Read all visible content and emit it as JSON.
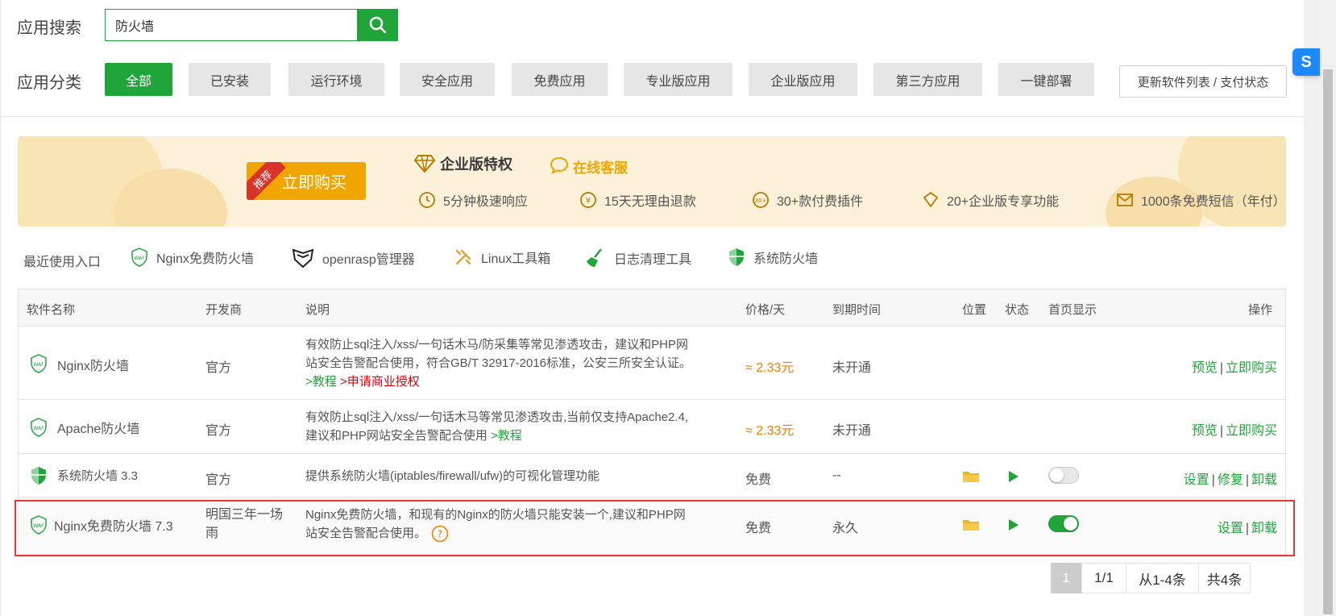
{
  "search": {
    "label": "应用搜索",
    "value": "防火墙"
  },
  "categories": {
    "label": "应用分类",
    "items": [
      "全部",
      "已安装",
      "运行环境",
      "安全应用",
      "免费应用",
      "专业版应用",
      "企业版应用",
      "第三方应用",
      "一键部署"
    ],
    "update_button": "更新软件列表 / 支付状态"
  },
  "banner": {
    "ribbon": "推荐",
    "buy": "立即购买",
    "ent_title": "企业版特权",
    "cs_title": "在线客服",
    "perks": [
      "5分钟极速响应",
      "15天无理由退款",
      "30+款付费插件",
      "20+企业版专享功能",
      "1000条免费短信（年付）"
    ]
  },
  "recent": {
    "label": "最近使用入口",
    "items": [
      "Nginx免费防火墙",
      "openrasp管理器",
      "Linux工具箱",
      "日志清理工具",
      "系统防火墙"
    ]
  },
  "table": {
    "headers": [
      "软件名称",
      "开发商",
      "说明",
      "价格/天",
      "到期时间",
      "位置",
      "状态",
      "首页显示",
      "操作"
    ],
    "rows": [
      {
        "name": "Nginx防火墙",
        "vendor": "官方",
        "desc_line1": "有效防止sql注入/xss/一句话木马/防采集等常见渗透攻击，建议和PHP网",
        "desc_line2": "站安全告警配合使用，符合GB/T 32917-2016标准，公安三所安全认证。",
        "link1": ">教程",
        "link2": ">申请商业授权",
        "price": "≈ 2.33元",
        "expire": "未开通",
        "op1": "预览",
        "op2": "立即购买"
      },
      {
        "name": "Apache防火墙",
        "vendor": "官方",
        "desc_line1": "有效防止sql注入/xss/一句话木马等常见渗透攻击,当前仅支持Apache2.4,",
        "desc_line2": "建议和PHP网站安全告警配合使用",
        "link1": ">教程",
        "price": "≈ 2.33元",
        "expire": "未开通",
        "op1": "预览",
        "op2": "立即购买"
      },
      {
        "name": "系统防火墙 3.3",
        "vendor": "官方",
        "desc_line1": "提供系统防火墙(iptables/firewall/ufw)的可视化管理功能",
        "price": "免费",
        "expire": "--",
        "home_display": false,
        "op1": "设置",
        "op2": "修复",
        "op3": "卸载"
      },
      {
        "name": "Nginx免费防火墙 7.3",
        "vendor_line1": "明国三年一场",
        "vendor_line2": "雨",
        "desc_line1": "Nginx免费防火墙，和现有的Nginx的防火墙只能安装一个,建议和PHP网",
        "desc_line2": "站安全告警配合使用。",
        "price": "免费",
        "expire": "永久",
        "home_display": true,
        "op1": "设置",
        "op2": "卸载"
      }
    ]
  },
  "pagination": {
    "current": "1",
    "pages": "1/1",
    "range": "从1-4条",
    "total": "共4条"
  },
  "colors": {
    "accent": "#20a53a",
    "price": "#f27c00",
    "highlight": "#e53935"
  }
}
